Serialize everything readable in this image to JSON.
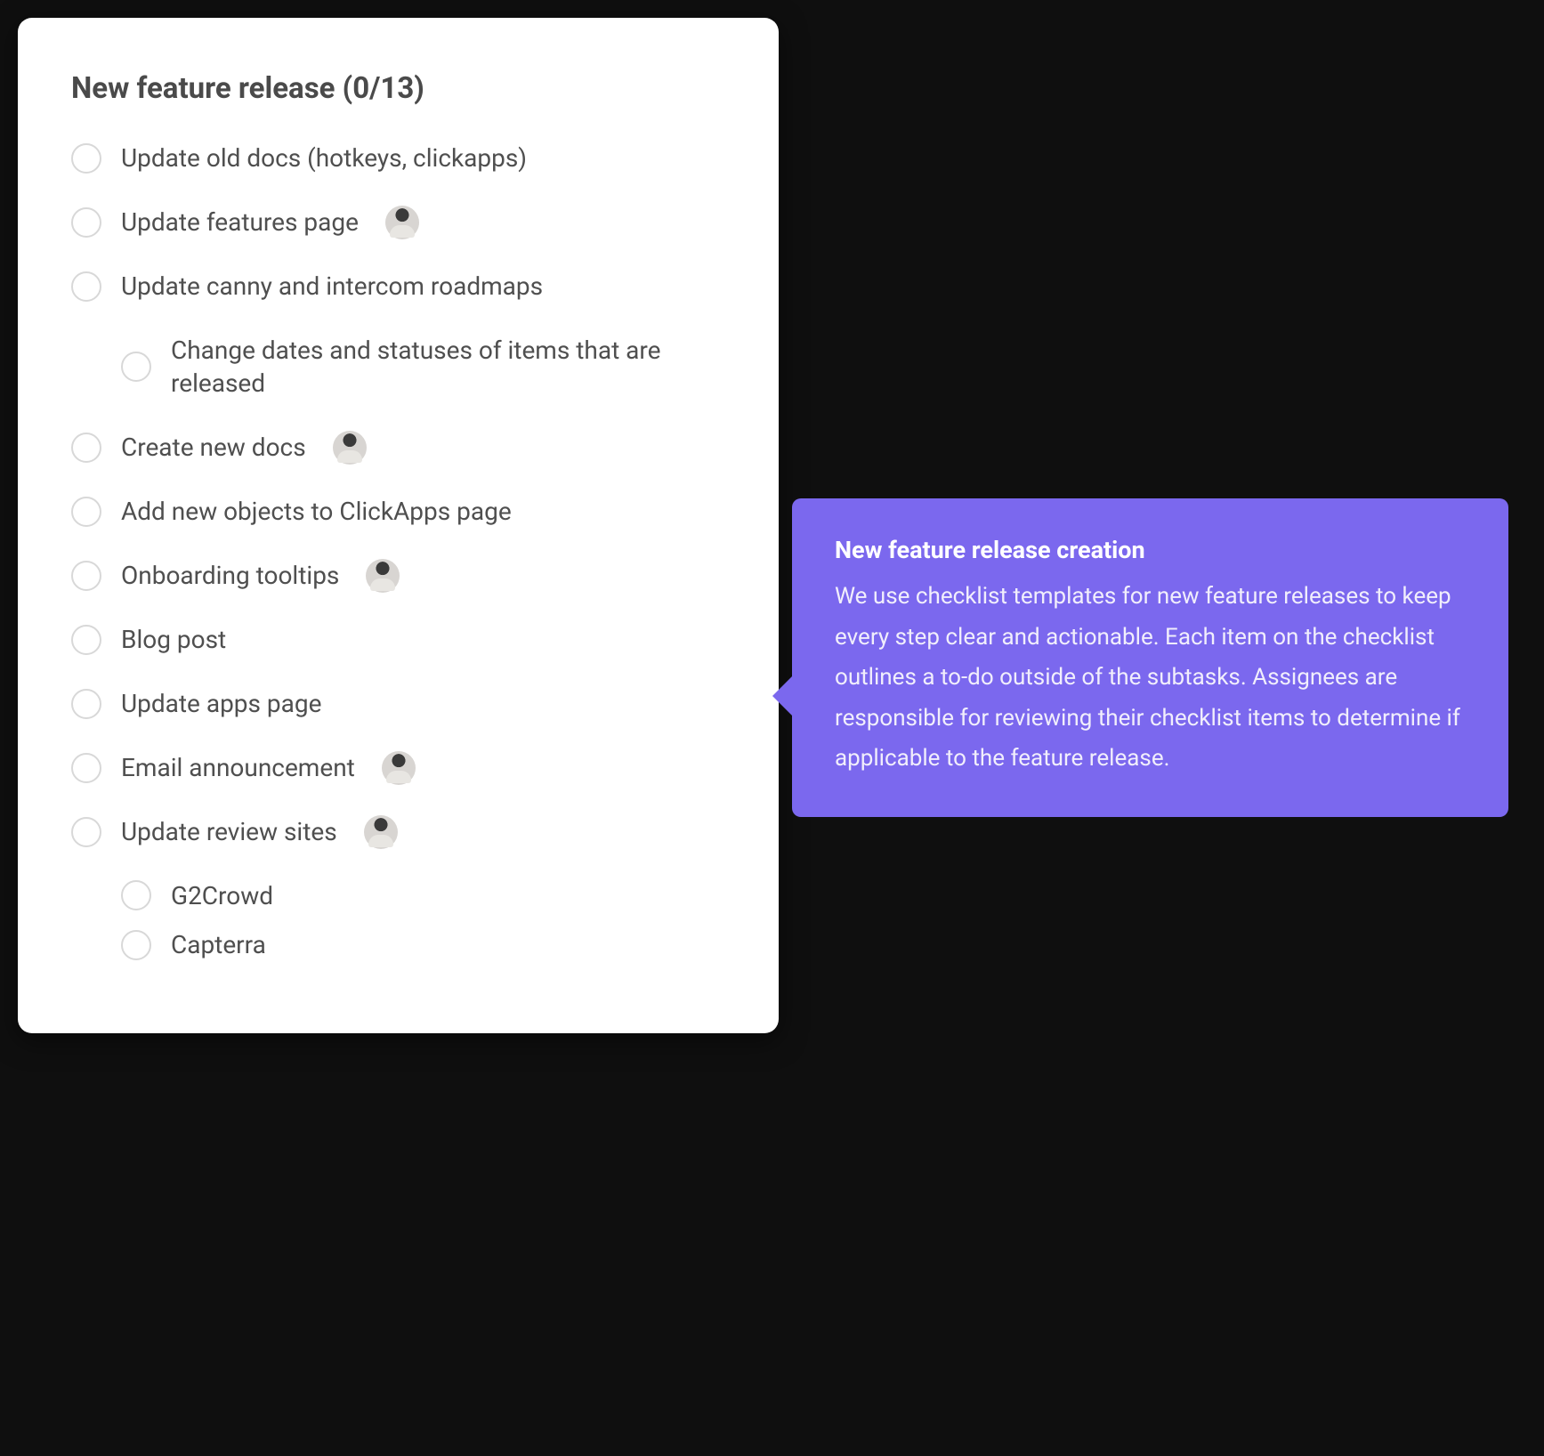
{
  "checklist": {
    "title": "New feature release (0/13)",
    "items": [
      {
        "label": "Update old docs (hotkeys, clickapps)",
        "has_avatar": false,
        "children": []
      },
      {
        "label": "Update features page",
        "has_avatar": true,
        "children": []
      },
      {
        "label": "Update canny and intercom roadmaps",
        "has_avatar": false,
        "children": [
          {
            "label": "Change dates and statuses of items that are released",
            "has_avatar": false
          }
        ]
      },
      {
        "label": "Create new docs",
        "has_avatar": true,
        "children": []
      },
      {
        "label": "Add new objects to ClickApps page",
        "has_avatar": false,
        "children": []
      },
      {
        "label": "Onboarding tooltips",
        "has_avatar": true,
        "children": []
      },
      {
        "label": "Blog post",
        "has_avatar": false,
        "children": []
      },
      {
        "label": "Update apps page",
        "has_avatar": false,
        "children": []
      },
      {
        "label": "Email announcement",
        "has_avatar": true,
        "children": []
      },
      {
        "label": "Update review sites",
        "has_avatar": true,
        "children": [
          {
            "label": "G2Crowd",
            "has_avatar": false
          },
          {
            "label": "Capterra",
            "has_avatar": false
          }
        ]
      }
    ]
  },
  "tooltip": {
    "title": "New feature release creation",
    "body": "We use checklist templates for new feature releases to keep every step clear and actionable. Each item on the checklist outlines a to-do outside of the subtasks. Assignees are responsible for reviewing their checklist items to determine if applicable to the feature release."
  }
}
